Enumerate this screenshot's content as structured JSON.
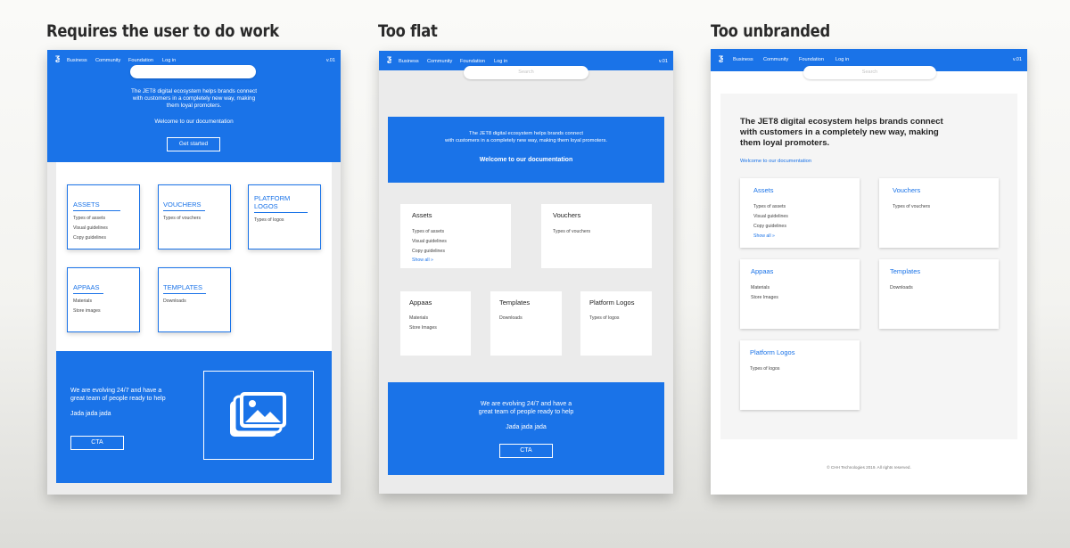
{
  "headings": {
    "m1": "Requires the user to do work",
    "m2": "Too flat",
    "m3": "Too unbranded"
  },
  "colors": {
    "brand_blue": "#1a73e8",
    "flat_gray": "#ebebeb",
    "white": "#ffffff"
  },
  "nav": {
    "logo_icon": "jet8-logo-icon",
    "links": [
      "Business",
      "Community",
      "Foundation",
      "Log in"
    ],
    "version": "v.01",
    "search_placeholder": "Search"
  },
  "hero": {
    "tagline_1": "The JET8 digital ecosystem helps brands connect",
    "tagline_2": "with customers in a completely new way, making",
    "tagline_3": "them loyal promoters.",
    "tagline_flat_1": "The JET8 digital ecosystem helps brands connect",
    "tagline_flat_2": "with customers in a completely new way, making them loyal promoters.",
    "welcome": "Welcome to our documentation",
    "get_started": "Get started"
  },
  "m1_cards": {
    "assets": {
      "title": "ASSETS",
      "items": [
        "Types of assets",
        "Visual guidelines",
        "Copy guidelines"
      ]
    },
    "vouchers": {
      "title": "VOUCHERS",
      "items": [
        "Types of vouchers"
      ]
    },
    "platform_logos": {
      "title_1": "PLATFORM",
      "title_2": "LOGOS",
      "items": [
        "Types of logos"
      ]
    },
    "appaas": {
      "title": "APPAAS",
      "items": [
        "Materials",
        "Store images"
      ]
    },
    "templates": {
      "title": "TEMPLATES",
      "items": [
        "Downloads"
      ]
    }
  },
  "cards": {
    "assets": {
      "title": "Assets",
      "items": [
        "Types of assets",
        "Visual guidelines",
        "Copy guidelines"
      ],
      "show_all": "Show all »"
    },
    "vouchers": {
      "title": "Vouchers",
      "items": [
        "Types of vouchers"
      ]
    },
    "appaas": {
      "title": "Appaas",
      "items": [
        "Materials",
        "Store Images"
      ]
    },
    "templates": {
      "title": "Templates",
      "items": [
        "Downloads"
      ]
    },
    "platform_logos": {
      "title": "Platform Logos",
      "items": [
        "Types of logos"
      ]
    }
  },
  "footer_cta": {
    "line_1": "We are evolving 24/7 and have a",
    "line_2": "great team of people ready to help",
    "sub": "Jada jada jada",
    "cta": "CTA",
    "image_icon": "image-gallery-icon"
  },
  "copyright": "© CHH Technologies 2019. All rights reserved."
}
